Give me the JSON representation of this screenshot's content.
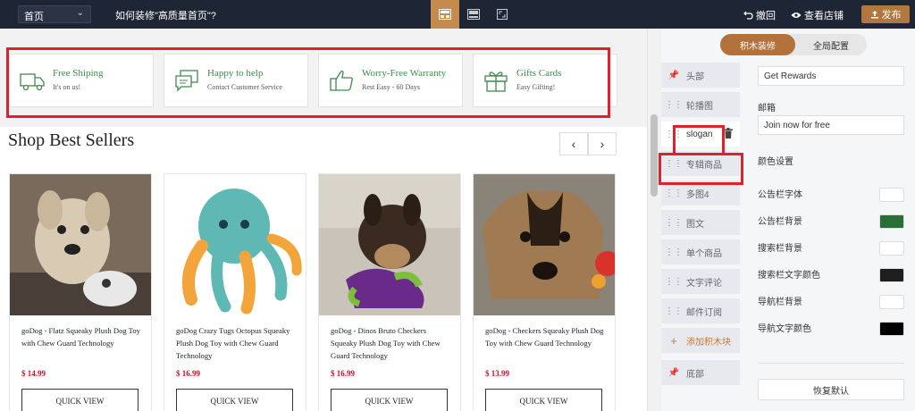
{
  "topbar": {
    "page_select": "首页",
    "editor_title": "如何装修\"高质量首页\"?",
    "undo_label": "撤回",
    "view_store_label": "查看店铺",
    "publish_label": "发布"
  },
  "preview": {
    "features": [
      {
        "title": "Free Shiping",
        "subtitle": "It's on us!",
        "icon": "truck-icon"
      },
      {
        "title": "Happy to help",
        "subtitle": "Contact Customer Service",
        "icon": "chat-icon"
      },
      {
        "title": "Worry-Free Warranty",
        "subtitle": "Rest Easy - 60 Days",
        "icon": "thumbs-up-icon"
      },
      {
        "title": "Gifts Cards",
        "subtitle": "Easy Gifting!",
        "icon": "gift-icon"
      }
    ],
    "section_title": "Shop Best Sellers",
    "products": [
      {
        "name": "goDog - Flatz Squeaky Plush Dog Toy with Chew Guard Technology",
        "price": "$ 14.99",
        "button": "QUICK VIEW"
      },
      {
        "name": "goDog Crazy Tugs Octopus Squeaky Plush Dog Toy with Chew Guard Technology",
        "price": "$ 16.99",
        "button": "QUICK VIEW"
      },
      {
        "name": "goDog - Dinos Bruto Checkers Squeaky Plush Dog Toy with Chew Guard Technology",
        "price": "$ 16.99",
        "button": "QUICK VIEW"
      },
      {
        "name": "goDog - Checkers Squeaky Plush Dog Toy with Chew Guard Technology",
        "price": "$ 13.99",
        "button": "QUICK VIEW"
      }
    ]
  },
  "panel": {
    "tabs": [
      "积木装修",
      "全局配置"
    ],
    "blocks": [
      {
        "label": "头部",
        "icon": "pin-icon"
      },
      {
        "label": "轮播图",
        "icon": "drag-handle-icon"
      },
      {
        "label": "slogan",
        "icon": "drag-handle-icon"
      },
      {
        "label": "专辑商品",
        "icon": "drag-handle-icon"
      },
      {
        "label": "多图4",
        "icon": "drag-handle-icon"
      },
      {
        "label": "图文",
        "icon": "drag-handle-icon"
      },
      {
        "label": "单个商品",
        "icon": "drag-handle-icon"
      },
      {
        "label": "文字评论",
        "icon": "drag-handle-icon"
      },
      {
        "label": "邮件订阅",
        "icon": "drag-handle-icon"
      },
      {
        "label": "添加积木块",
        "icon": "plus-icon"
      },
      {
        "label": "底部",
        "icon": "pin-icon"
      }
    ],
    "settings": {
      "rewards_value": "Get Rewards",
      "email_label": "邮箱",
      "email_value": "Join now for free",
      "color_header": "颜色设置",
      "colors": [
        {
          "label": "公告栏字体",
          "color": "#ffffff"
        },
        {
          "label": "公告栏背景",
          "color": "#2a6e37"
        },
        {
          "label": "搜索栏背景",
          "color": "#ffffff"
        },
        {
          "label": "搜索栏文字颜色",
          "color": "#1e1e1e"
        },
        {
          "label": "导航栏背景",
          "color": "#ffffff"
        },
        {
          "label": "导航文字颜色",
          "color": "#000000"
        }
      ],
      "reset_label": "恢复默认"
    }
  }
}
